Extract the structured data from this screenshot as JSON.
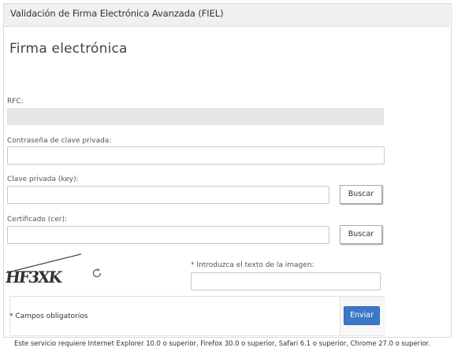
{
  "panel": {
    "title": "Validación de Firma Electrónica Avanzada (FIEL)"
  },
  "section": {
    "title": "Firma electrónica"
  },
  "form": {
    "rfc_label": "RFC:",
    "rfc_value": "",
    "password_label": "Contraseña de clave privada:",
    "password_value": "",
    "key_label": "Clave privada (key):",
    "key_value": "",
    "key_button": "Buscar",
    "cert_label": "Certificado (cer):",
    "cert_value": "",
    "cert_button": "Buscar",
    "captcha_label": "* Introduzca el texto de la imagen:",
    "captcha_value": ""
  },
  "captcha": {
    "text": "HF3XK",
    "refresh_icon": "refresh-icon"
  },
  "footer": {
    "required_note": "* Campos obligatorios",
    "submit_label": "Enviar",
    "browser_note": "Este servicio requiere Internet Explorer 10.0 o superior, Firefox 30.0 o superior, Safari 6.1 o superior, Chrome 27.0 o superior."
  },
  "colors": {
    "accent": "#3b78c8",
    "readonly_field": "#e6e6e6",
    "header_bg": "#f0f0f0"
  }
}
